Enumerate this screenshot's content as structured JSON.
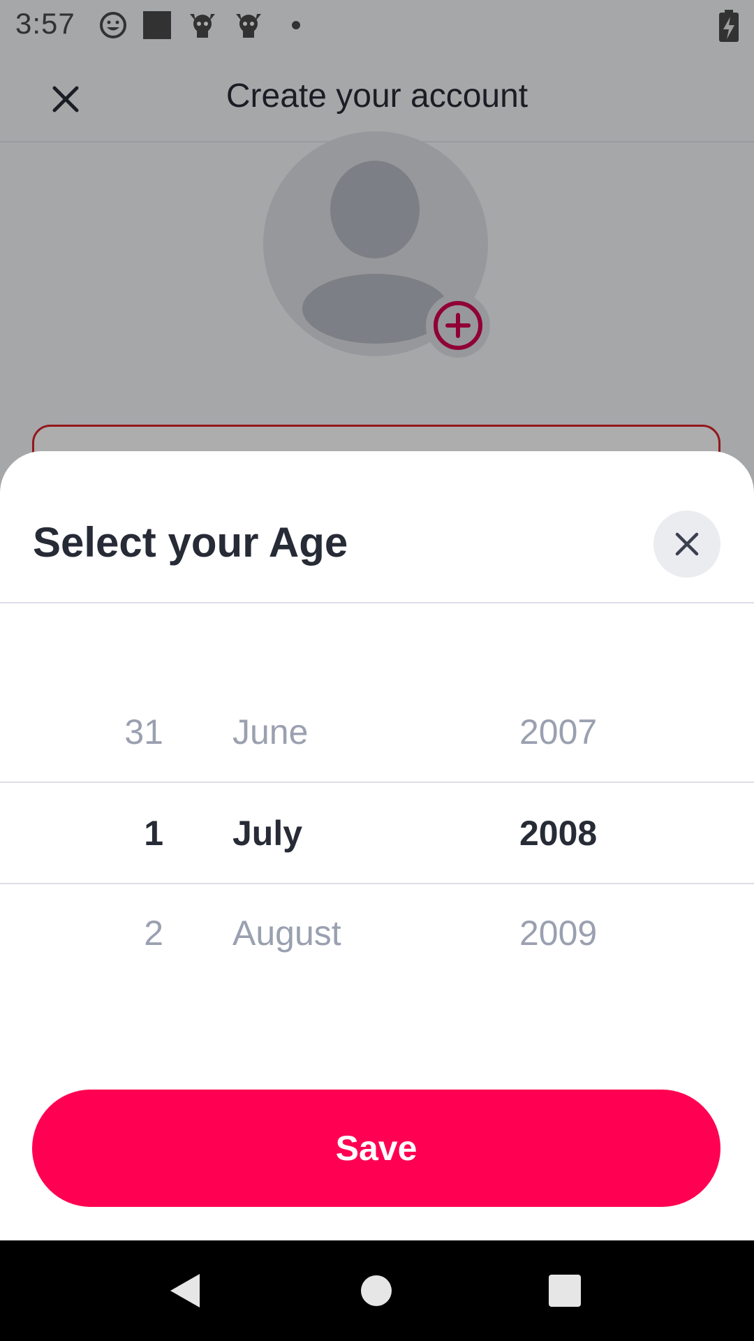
{
  "status_bar": {
    "time": "3:57",
    "icons": [
      "emoji-notification-icon",
      "square-notification-icon",
      "skull-notification-icon",
      "skull-notification-icon",
      "dot-icon",
      "battery-charging-icon"
    ]
  },
  "app_bar": {
    "title": "Create your account",
    "close_icon": "close-icon"
  },
  "avatar": {
    "placeholder_icon": "person-icon",
    "add_icon": "add-circle-icon"
  },
  "sheet": {
    "title": "Select your Age",
    "close_icon": "close-icon",
    "picker": {
      "rows": [
        {
          "day": "31",
          "month": "June",
          "year": "2007",
          "selected": false
        },
        {
          "day": "1",
          "month": "July",
          "year": "2008",
          "selected": true
        },
        {
          "day": "2",
          "month": "August",
          "year": "2009",
          "selected": false
        }
      ]
    },
    "save_label": "Save"
  },
  "nav_bar": {
    "icons": [
      "back-icon",
      "home-icon",
      "recents-icon"
    ]
  },
  "colors": {
    "accent": "#ff0052",
    "error_border": "#d8232a",
    "text_dark": "#272b36",
    "text_muted": "#9aa0b0"
  }
}
